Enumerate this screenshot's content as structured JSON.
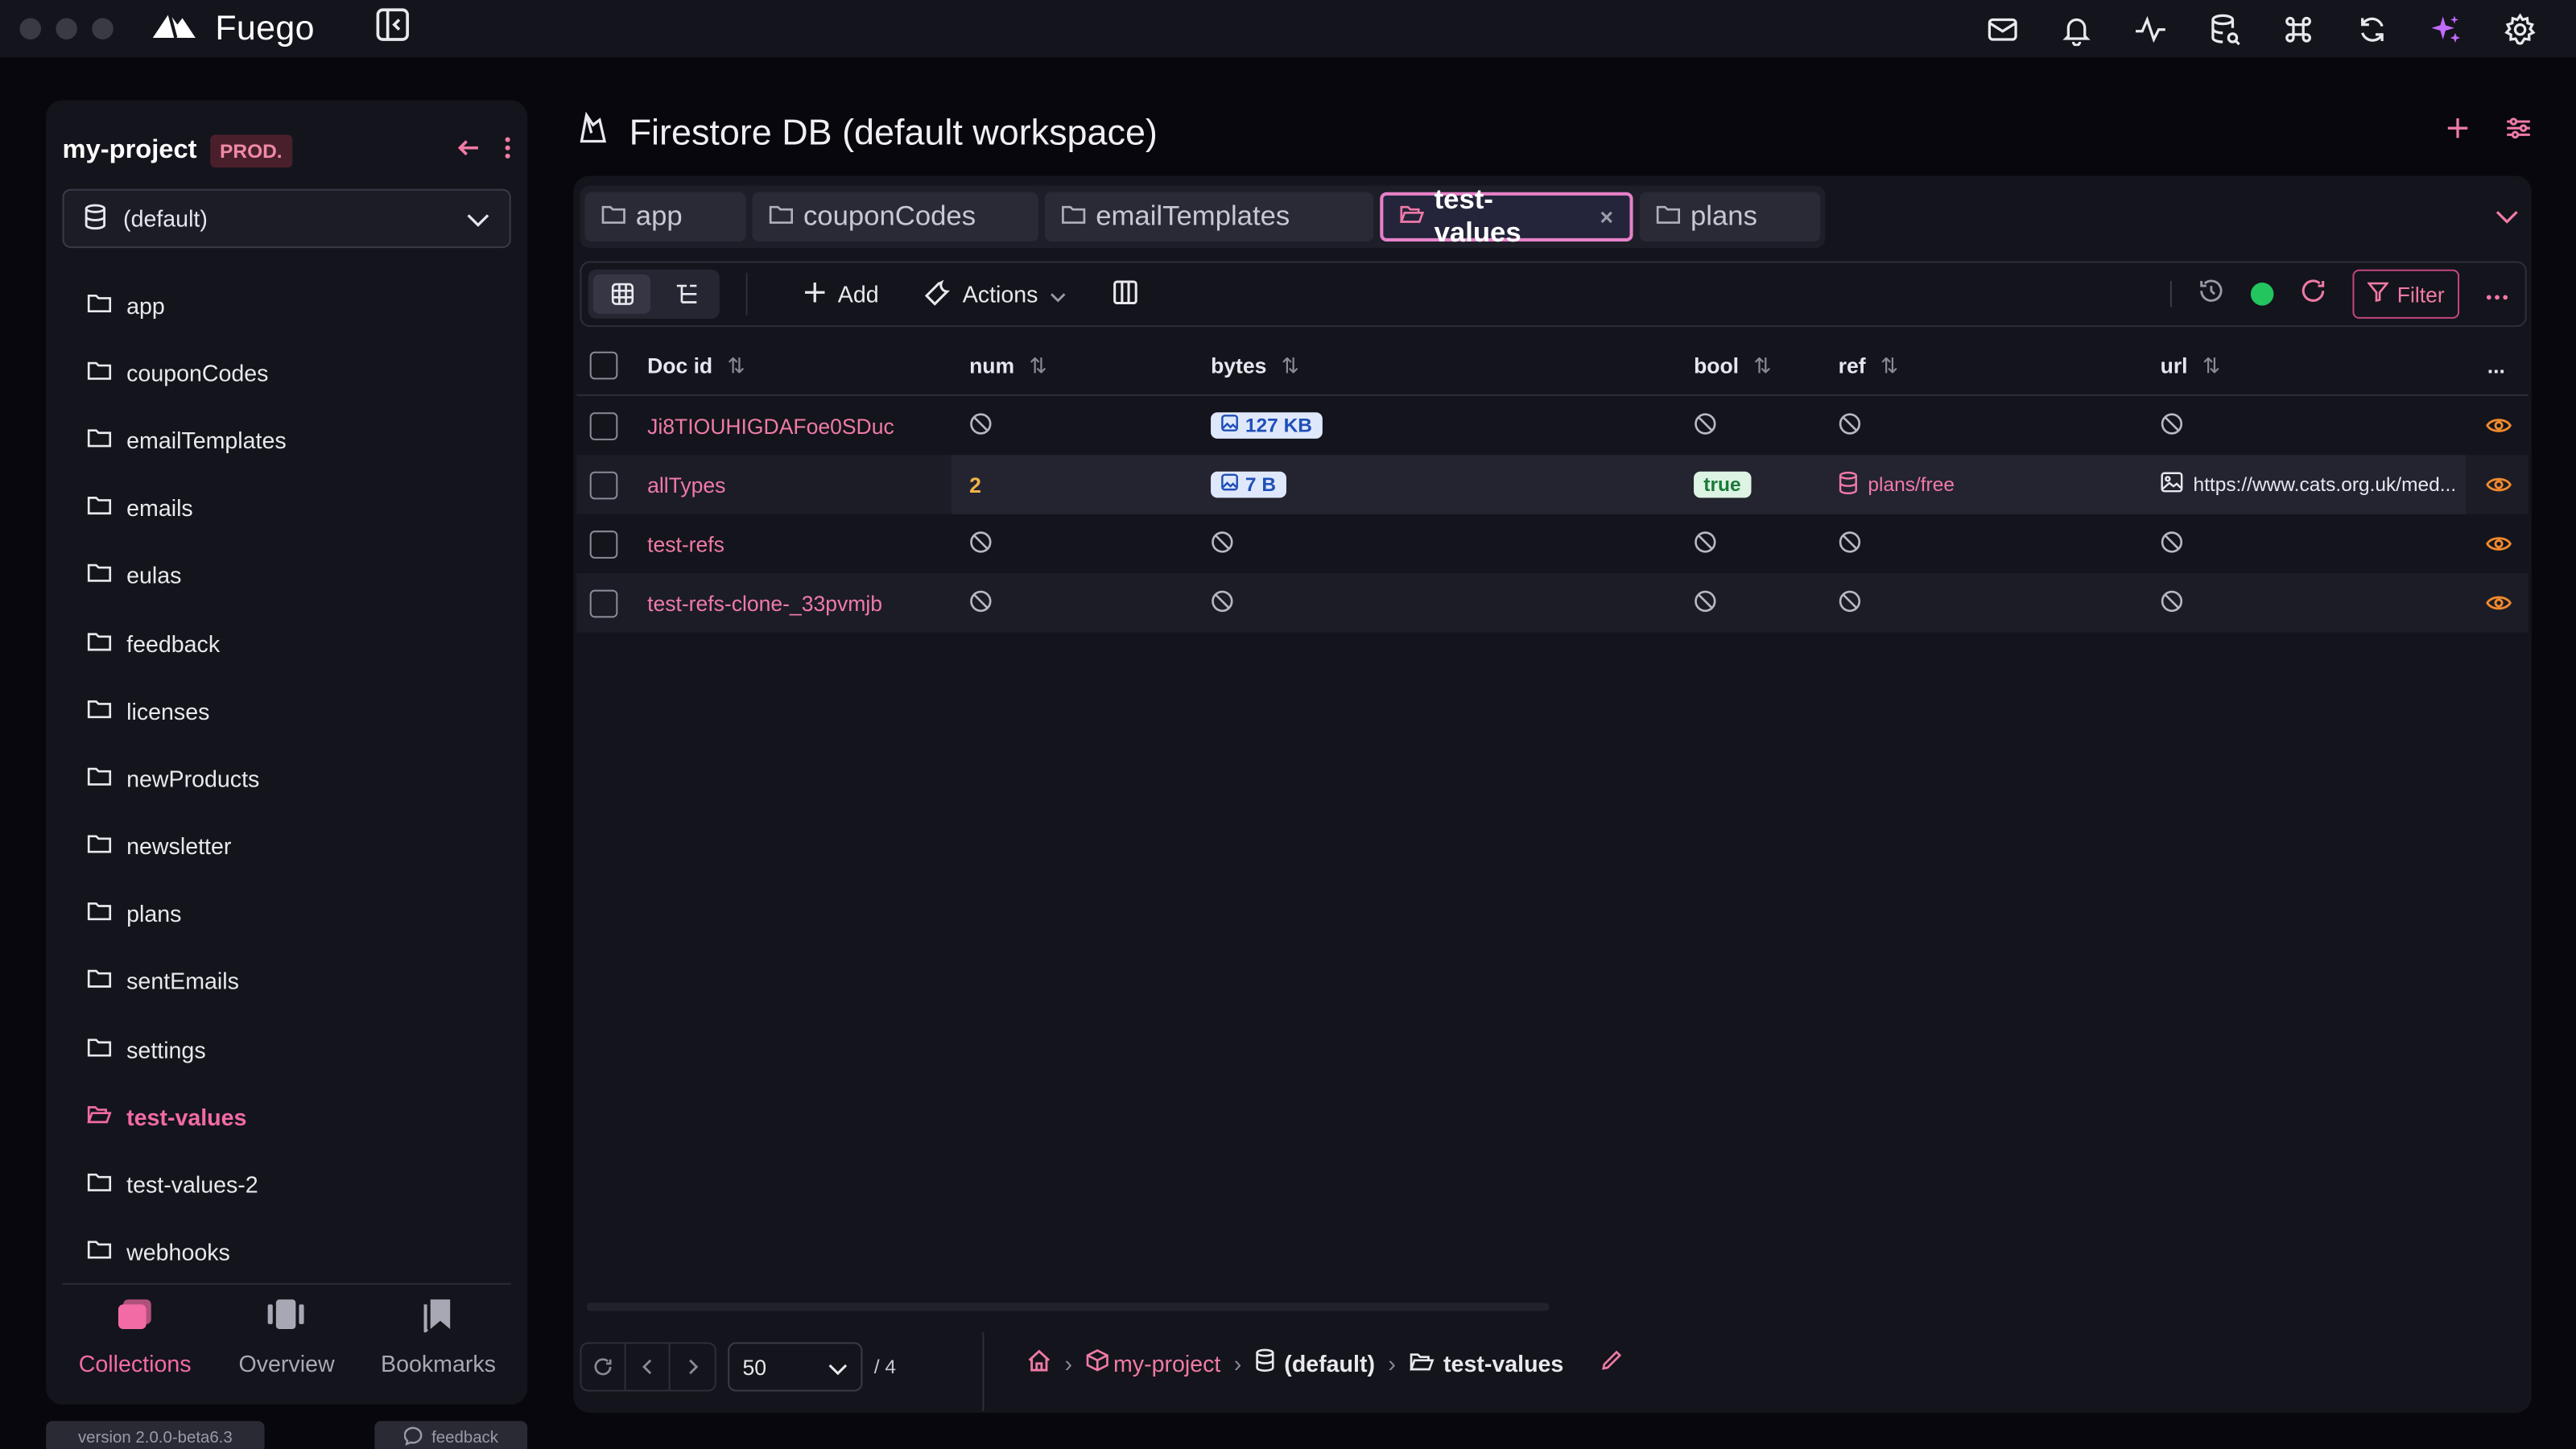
{
  "app": {
    "name": "Fuego",
    "accent": "#f26ba5"
  },
  "top_icons": [
    "mail-question-icon",
    "bell-icon",
    "activity-icon",
    "database-search-icon",
    "command-icon",
    "sync-icon",
    "sparkles-icon",
    "settings-icon"
  ],
  "sidebar": {
    "project_name": "my-project",
    "project_badge": "PROD.",
    "workspace": "(default)",
    "collections": [
      {
        "label": "app"
      },
      {
        "label": "couponCodes"
      },
      {
        "label": "emailTemplates"
      },
      {
        "label": "emails"
      },
      {
        "label": "eulas"
      },
      {
        "label": "feedback"
      },
      {
        "label": "licenses"
      },
      {
        "label": "newProducts"
      },
      {
        "label": "newsletter"
      },
      {
        "label": "plans"
      },
      {
        "label": "sentEmails"
      },
      {
        "label": "settings"
      },
      {
        "label": "test-values",
        "active": true
      },
      {
        "label": "test-values-2"
      },
      {
        "label": "webhooks"
      }
    ],
    "tabs": [
      {
        "label": "Collections",
        "active": true
      },
      {
        "label": "Overview"
      },
      {
        "label": "Bookmarks"
      }
    ],
    "version": "version 2.0.0-beta6.3",
    "feedback": "feedback"
  },
  "main": {
    "title": "Firestore DB (default workspace)",
    "tabs": [
      {
        "label": "app"
      },
      {
        "label": "couponCodes"
      },
      {
        "label": "emailTemplates"
      },
      {
        "label": "test-values",
        "active": true
      },
      {
        "label": "plans"
      }
    ],
    "toolbar": {
      "add": "Add",
      "actions": "Actions",
      "filter": "Filter"
    },
    "columns": [
      "Doc id",
      "num",
      "bytes",
      "bool",
      "ref",
      "url",
      "..."
    ],
    "rows": [
      {
        "doc_id": "Ji8TIOUHIGDAFoe0SDuc",
        "num": null,
        "bytes": "127 KB",
        "bool": null,
        "ref": null,
        "url": null
      },
      {
        "doc_id": "allTypes",
        "num": "2",
        "bytes": "7 B",
        "bool": "true",
        "ref": "plans/free",
        "url": "https://www.cats.org.uk/med..."
      },
      {
        "doc_id": "test-refs",
        "num": null,
        "bytes": null,
        "bool": null,
        "ref": null,
        "url": null
      },
      {
        "doc_id": "test-refs-clone-_33pvmjb",
        "num": null,
        "bytes": null,
        "bool": null,
        "ref": null,
        "url": null
      }
    ],
    "pager": {
      "page_size": "50",
      "total": "/ 4"
    },
    "breadcrumb": {
      "project": "my-project",
      "workspace": "(default)",
      "collection": "test-values"
    }
  }
}
